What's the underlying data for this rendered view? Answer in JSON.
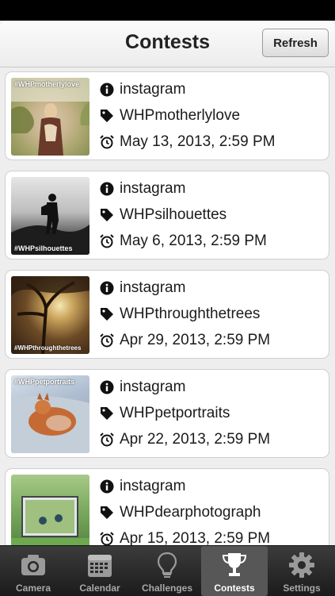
{
  "navbar": {
    "title": "Contests",
    "refresh_label": "Refresh"
  },
  "contests": [
    {
      "source": "instagram",
      "tag": "WHPmotherlylove",
      "date": "May 13, 2013, 2:59 PM",
      "thumb_tag": "#WHPmotherlylove"
    },
    {
      "source": "instagram",
      "tag": "WHPsilhouettes",
      "date": "May 6, 2013, 2:59 PM",
      "thumb_tag": "#WHPsilhouettes"
    },
    {
      "source": "instagram",
      "tag": "WHPthroughthetrees",
      "date": "Apr 29, 2013, 2:59 PM",
      "thumb_tag": "#WHPthroughthetrees"
    },
    {
      "source": "instagram",
      "tag": "WHPpetportraits",
      "date": "Apr 22, 2013, 2:59 PM",
      "thumb_tag": "#WHPpetportraits"
    },
    {
      "source": "instagram",
      "tag": "WHPdearphotograph",
      "date": "Apr 15, 2013, 2:59 PM",
      "thumb_tag": ""
    }
  ],
  "tabs": [
    {
      "label": "Camera",
      "icon": "camera-icon"
    },
    {
      "label": "Calendar",
      "icon": "calendar-icon"
    },
    {
      "label": "Challenges",
      "icon": "lightbulb-icon"
    },
    {
      "label": "Contests",
      "icon": "trophy-icon"
    },
    {
      "label": "Settings",
      "icon": "gear-icon"
    }
  ],
  "colors": {
    "navbar_bg": "#f6f6f6",
    "tabbar_bg": "#2a2a2a",
    "active_tab_bg": "#575757",
    "text": "#1b1b1b"
  }
}
